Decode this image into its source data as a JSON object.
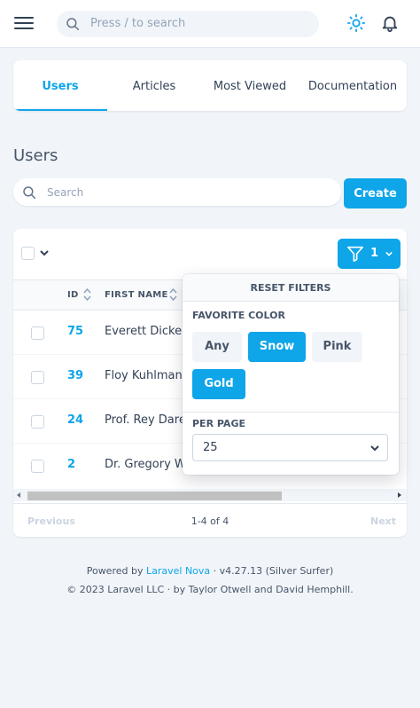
{
  "header": {
    "search_placeholder": "Press / to search",
    "icons": {
      "menu": "hamburger-icon",
      "search": "search-icon",
      "theme": "sun-icon",
      "notifications": "bell-icon"
    }
  },
  "tabs": [
    {
      "label": "Users",
      "active": true
    },
    {
      "label": "Articles",
      "active": false
    },
    {
      "label": "Most Viewed",
      "active": false
    },
    {
      "label": "Documentation",
      "active": false
    }
  ],
  "page": {
    "title": "Users",
    "search_placeholder": "Search",
    "create_label": "Create"
  },
  "filter": {
    "active_count": "1"
  },
  "table": {
    "columns": [
      "ID",
      "FIRST NAME"
    ],
    "rows": [
      {
        "id": "75",
        "first_name": "Everett Dicken"
      },
      {
        "id": "39",
        "first_name": "Floy Kuhlman"
      },
      {
        "id": "24",
        "first_name": "Prof. Rey Dare"
      },
      {
        "id": "2",
        "first_name": "Dr. Gregory W"
      }
    ]
  },
  "pagination": {
    "previous": "Previous",
    "info": "1-4 of 4",
    "next": "Next"
  },
  "filter_menu": {
    "reset_label": "RESET FILTERS",
    "favorite_color_label": "FAVORITE COLOR",
    "color_options": [
      {
        "label": "Any",
        "selected": false
      },
      {
        "label": "Snow",
        "selected": true
      },
      {
        "label": "Pink",
        "selected": false
      },
      {
        "label": "Gold",
        "selected": true
      }
    ],
    "per_page_label": "PER PAGE",
    "per_page_value": "25"
  },
  "footer": {
    "powered_prefix": "Powered by",
    "nova_link": "Laravel Nova",
    "version": "· v4.27.13 (Silver Surfer)",
    "copyright": "© 2023 Laravel LLC · by Taylor Otwell and David Hemphill."
  },
  "colors": {
    "accent": "#0ea5e9",
    "background": "#f1f5f9",
    "text": "#334155"
  }
}
